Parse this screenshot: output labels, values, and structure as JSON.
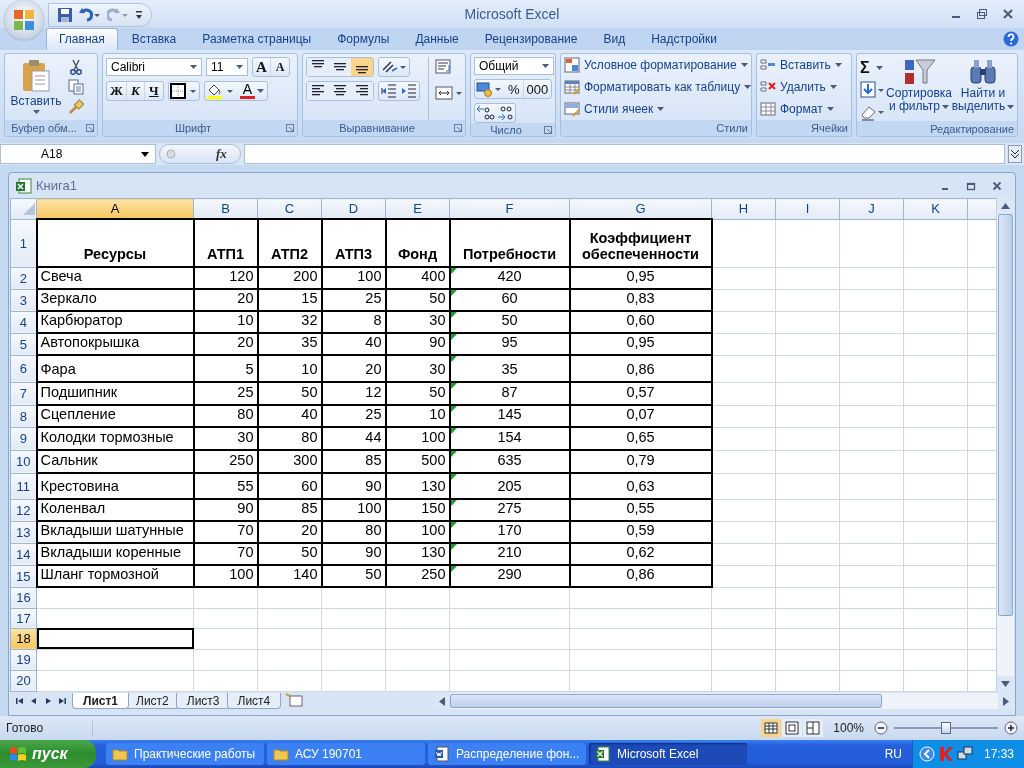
{
  "window": {
    "title": "Microsoft Excel"
  },
  "tabs": [
    {
      "label": "Главная",
      "selected": true
    },
    {
      "label": "Вставка",
      "selected": false
    },
    {
      "label": "Разметка страницы",
      "selected": false
    },
    {
      "label": "Формулы",
      "selected": false
    },
    {
      "label": "Данные",
      "selected": false
    },
    {
      "label": "Рецензирование",
      "selected": false
    },
    {
      "label": "Вид",
      "selected": false
    },
    {
      "label": "Надстройки",
      "selected": false
    }
  ],
  "clipboard": {
    "label": "Буфер обм...",
    "paste": "Вставить"
  },
  "font": {
    "label": "Шрифт",
    "name": "Calibri",
    "size": "11",
    "grow": "A",
    "shrink": "A",
    "bold": "Ж",
    "italic": "К",
    "underline": "Ч",
    "color_letter": "A"
  },
  "alignment": {
    "label": "Выравнивание",
    "vertical": [
      {
        "kind": "top",
        "selected": false
      },
      {
        "kind": "middle",
        "selected": false
      },
      {
        "kind": "bottom",
        "selected": true
      }
    ],
    "horizontal": [
      {
        "kind": "left",
        "selected": false
      },
      {
        "kind": "center",
        "selected": false
      },
      {
        "kind": "right",
        "selected": false
      }
    ]
  },
  "number": {
    "label": "Число",
    "format": "Общий",
    "percent": "%",
    "thousands": "000"
  },
  "styles": {
    "label": "Стили",
    "items": [
      {
        "kind": "conditional",
        "label": "Условное форматирование"
      },
      {
        "kind": "table",
        "label": "Форматировать как таблицу"
      },
      {
        "kind": "cellstyle",
        "label": "Стили ячеек"
      }
    ]
  },
  "cells_group": {
    "label": "Ячейки",
    "items": [
      {
        "kind": "insert",
        "label": "Вставить"
      },
      {
        "kind": "delete",
        "label": "Удалить"
      },
      {
        "kind": "format",
        "label": "Формат"
      }
    ]
  },
  "editing": {
    "label": "Редактирование",
    "sum": "Σ",
    "sort": [
      "Сортировка",
      "и фильтр"
    ],
    "find": [
      "Найти и",
      "выделить"
    ]
  },
  "formula_bar": {
    "name_box": "A18",
    "fx": "fx"
  },
  "workbook": {
    "title": "Книга1",
    "columns": [
      {
        "label": "A",
        "selected": true
      },
      {
        "label": "B",
        "selected": false
      },
      {
        "label": "C",
        "selected": false
      },
      {
        "label": "D",
        "selected": false
      },
      {
        "label": "E",
        "selected": false
      },
      {
        "label": "F",
        "selected": false
      },
      {
        "label": "G",
        "selected": false
      },
      {
        "label": "H",
        "selected": false
      },
      {
        "label": "I",
        "selected": false
      },
      {
        "label": "J",
        "selected": false
      },
      {
        "label": "K",
        "selected": false
      }
    ],
    "rows": [
      {
        "number": "1",
        "selected": false,
        "warning": false,
        "cells": [
          "Ресурсы",
          "АТП1",
          "АТП2",
          "АТП3",
          "Фонд",
          "Потребности",
          "Коэффициент обеспеченности"
        ]
      },
      {
        "number": "2",
        "selected": false,
        "warning": true,
        "cells": [
          "Свеча",
          "120",
          "200",
          "100",
          "400",
          "420",
          "0,95"
        ]
      },
      {
        "number": "3",
        "selected": false,
        "warning": true,
        "cells": [
          "Зеркало",
          "20",
          "15",
          "25",
          "50",
          "60",
          "0,83"
        ]
      },
      {
        "number": "4",
        "selected": false,
        "warning": true,
        "cells": [
          "Карбюратор",
          "10",
          "32",
          "8",
          "30",
          "50",
          "0,60"
        ]
      },
      {
        "number": "5",
        "selected": false,
        "warning": true,
        "cells": [
          "Автопокрышка",
          "20",
          "35",
          "40",
          "90",
          "95",
          "0,95"
        ]
      },
      {
        "number": "6",
        "selected": false,
        "warning": true,
        "cells": [
          "Фара",
          "5",
          "10",
          "20",
          "30",
          "35",
          "0,86"
        ]
      },
      {
        "number": "7",
        "selected": false,
        "warning": true,
        "cells": [
          "Подшипник",
          "25",
          "50",
          "12",
          "50",
          "87",
          "0,57"
        ]
      },
      {
        "number": "8",
        "selected": false,
        "warning": true,
        "cells": [
          "Сцепление",
          "80",
          "40",
          "25",
          "10",
          "145",
          "0,07"
        ]
      },
      {
        "number": "9",
        "selected": false,
        "warning": true,
        "cells": [
          "Колодки тормозные",
          "30",
          "80",
          "44",
          "100",
          "154",
          "0,65"
        ]
      },
      {
        "number": "10",
        "selected": false,
        "warning": true,
        "cells": [
          "Сальник",
          "250",
          "300",
          "85",
          "500",
          "635",
          "0,79"
        ]
      },
      {
        "number": "11",
        "selected": false,
        "warning": true,
        "cells": [
          "Крестовина",
          "55",
          "60",
          "90",
          "130",
          "205",
          "0,63"
        ]
      },
      {
        "number": "12",
        "selected": false,
        "warning": true,
        "cells": [
          "Коленвал",
          "90",
          "85",
          "100",
          "150",
          "275",
          "0,55"
        ]
      },
      {
        "number": "13",
        "selected": false,
        "warning": true,
        "cells": [
          "Вкладыши шатунные",
          "70",
          "20",
          "80",
          "100",
          "170",
          "0,59"
        ]
      },
      {
        "number": "14",
        "selected": false,
        "warning": true,
        "cells": [
          "Вкладыши коренные",
          "70",
          "50",
          "90",
          "130",
          "210",
          "0,62"
        ]
      },
      {
        "number": "15",
        "selected": false,
        "warning": true,
        "cells": [
          "Шланг тормозной",
          "100",
          "140",
          "50",
          "250",
          "290",
          "0,86"
        ]
      },
      {
        "number": "16",
        "selected": false
      },
      {
        "number": "17",
        "selected": false
      },
      {
        "number": "18",
        "selected": true
      },
      {
        "number": "19",
        "selected": false
      },
      {
        "number": "20",
        "selected": false
      }
    ],
    "sheets": [
      {
        "label": "Лист1",
        "selected": true
      },
      {
        "label": "Лист2",
        "selected": false
      },
      {
        "label": "Лист3",
        "selected": false
      },
      {
        "label": "Лист4",
        "selected": false
      }
    ]
  },
  "status_bar": {
    "text": "Готово",
    "views": [
      {
        "kind": "normal",
        "selected": true
      },
      {
        "kind": "layout",
        "selected": false
      },
      {
        "kind": "pagebreak",
        "selected": false
      }
    ],
    "zoom": "100%",
    "level": 0.5
  },
  "taskbar": {
    "start": "пуск",
    "tasks": [
      {
        "kind": "folder",
        "label": "Практические работы",
        "selected": false
      },
      {
        "kind": "folder",
        "label": "АСУ 190701",
        "selected": false
      },
      {
        "kind": "document",
        "label": "Распределение фон...",
        "selected": false
      },
      {
        "kind": "spreadsheet",
        "label": "Microsoft Excel",
        "selected": true
      }
    ],
    "lang": "RU",
    "clock": "17:33"
  }
}
